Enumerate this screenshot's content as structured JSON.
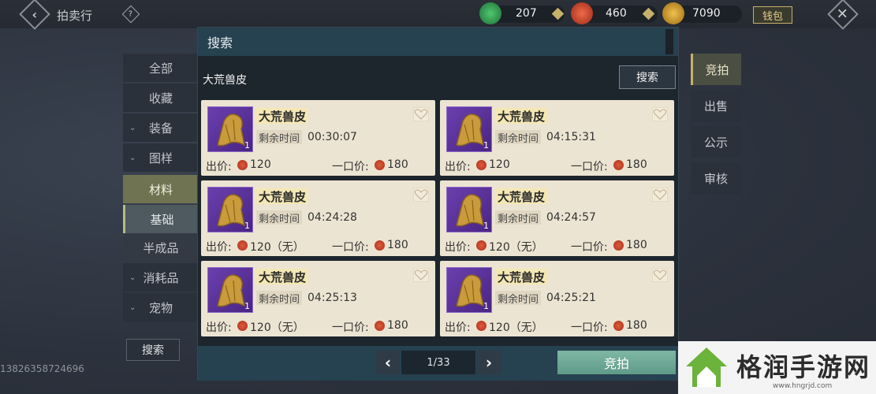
{
  "header": {
    "title": "拍卖行",
    "back_icon": "back-icon",
    "help_icon": "?",
    "currencies": [
      {
        "name": "jade",
        "value": "207",
        "color": "#2f9a4f"
      },
      {
        "name": "red-coin",
        "value": "460",
        "color": "#c2412a"
      },
      {
        "name": "gold-leaf",
        "value": "7090",
        "color": "#c7962b"
      }
    ],
    "wallet_label": "钱包",
    "close_icon": "✕"
  },
  "sidebar": {
    "items": [
      {
        "label": "全部",
        "chevron": ""
      },
      {
        "label": "收藏",
        "chevron": ""
      },
      {
        "label": "装备",
        "chevron": "⌄"
      },
      {
        "label": "图样",
        "chevron": "⌄"
      },
      {
        "label": "材料",
        "chevron": ""
      },
      {
        "label": "基础",
        "chevron": ""
      },
      {
        "label": "半成品",
        "chevron": ""
      },
      {
        "label": "消耗品",
        "chevron": "⌄"
      },
      {
        "label": "宠物",
        "chevron": "⌄"
      }
    ],
    "search_label": "搜索",
    "phone": "13826358724696"
  },
  "right_tabs": [
    "竞拍",
    "出售",
    "公示",
    "审核"
  ],
  "panel": {
    "title": "搜索",
    "query": "大荒兽皮",
    "search_button": "搜索",
    "labels": {
      "time": "剩余时间",
      "bid": "出价:",
      "buyout": "一口价:"
    },
    "listings": [
      {
        "name": "大荒兽皮",
        "qty": "1",
        "time": "00:30:07",
        "bid": "120",
        "buyout": "180"
      },
      {
        "name": "大荒兽皮",
        "qty": "1",
        "time": "04:15:31",
        "bid": "120",
        "buyout": "180"
      },
      {
        "name": "大荒兽皮",
        "qty": "1",
        "time": "04:24:28",
        "bid": "120（无）",
        "buyout": "180"
      },
      {
        "name": "大荒兽皮",
        "qty": "1",
        "time": "04:24:57",
        "bid": "120（无）",
        "buyout": "180"
      },
      {
        "name": "大荒兽皮",
        "qty": "1",
        "time": "04:25:13",
        "bid": "120（无）",
        "buyout": "180"
      },
      {
        "name": "大荒兽皮",
        "qty": "1",
        "time": "04:25:21",
        "bid": "120（无）",
        "buyout": "180"
      }
    ],
    "page": "1/33",
    "bid_button": "竞拍"
  },
  "watermark": {
    "text": "格润手游网",
    "url": "www.hngrjd.com"
  }
}
